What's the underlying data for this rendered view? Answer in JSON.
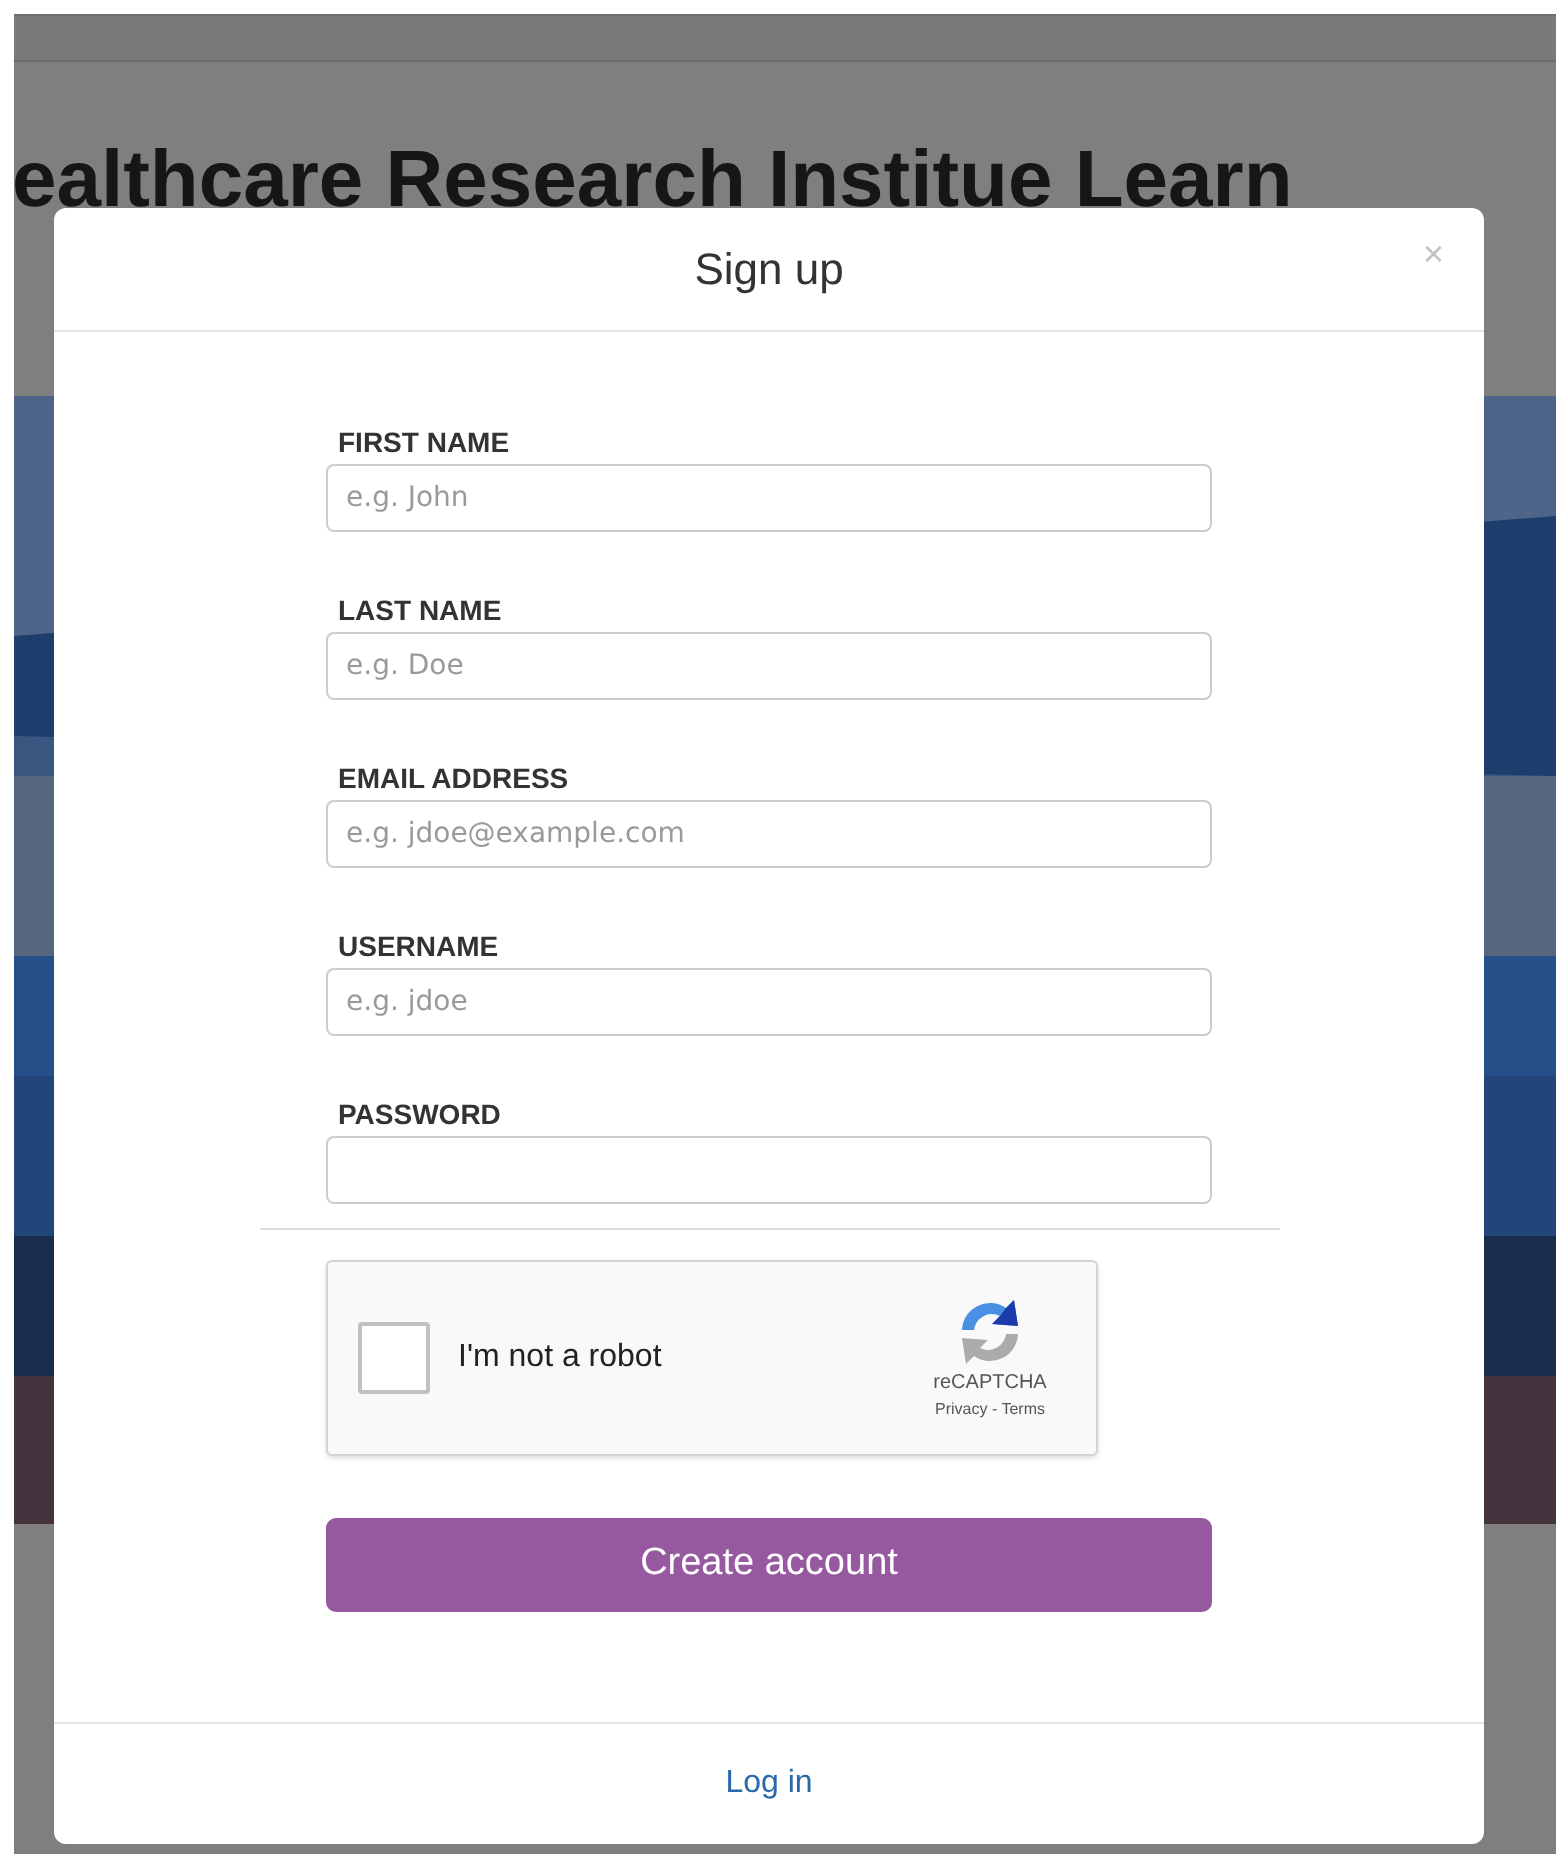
{
  "page": {
    "heading": "ealthcare Research Institue Learn"
  },
  "modal": {
    "title": "Sign up",
    "close": "×",
    "fields": [
      {
        "label": "FIRST NAME",
        "placeholder": "e.g. John"
      },
      {
        "label": "LAST NAME",
        "placeholder": "e.g. Doe"
      },
      {
        "label": "EMAIL ADDRESS",
        "placeholder": "e.g. jdoe@example.com"
      },
      {
        "label": "USERNAME",
        "placeholder": "e.g. jdoe"
      },
      {
        "label": "PASSWORD"
      }
    ],
    "captcha": {
      "label": "I'm not a robot",
      "checked": false,
      "brand": "reCAPTCHA",
      "links": "Privacy - Terms"
    },
    "submit": "Create account",
    "footer_link": "Log in"
  }
}
